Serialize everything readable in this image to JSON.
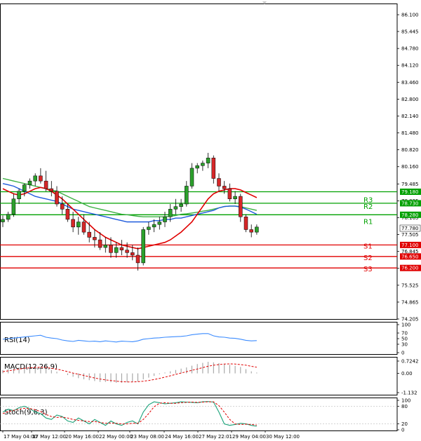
{
  "chart_data": {
    "type": "candlestick",
    "timeframe_labels": [
      "17 May 04:00",
      "17 May 12:00",
      "20 May 16:00",
      "22 May 00:00",
      "23 May 08:00",
      "24 May 16:00",
      "27 May 22:01",
      "29 May 04:00",
      "30 May 12:00"
    ],
    "price_ticks": [
      "86.100",
      "85.445",
      "84.780",
      "84.120",
      "83.460",
      "82.800",
      "82.140",
      "81.480",
      "80.820",
      "80.160",
      "79.485",
      "78.825",
      "78.165",
      "77.505",
      "76.845",
      "76.185",
      "75.525",
      "74.865",
      "74.205"
    ],
    "ylim": [
      74.205,
      86.1
    ],
    "current_price": "77.780",
    "candles": [
      {
        "o": 78.0,
        "h": 78.25,
        "l": 77.8,
        "c": 78.1
      },
      {
        "o": 78.1,
        "h": 78.4,
        "l": 78.0,
        "c": 78.3
      },
      {
        "o": 78.3,
        "h": 79.1,
        "l": 78.2,
        "c": 78.9
      },
      {
        "o": 78.9,
        "h": 79.3,
        "l": 78.7,
        "c": 79.2
      },
      {
        "o": 79.2,
        "h": 79.5,
        "l": 79.0,
        "c": 79.45
      },
      {
        "o": 79.45,
        "h": 79.7,
        "l": 79.3,
        "c": 79.6
      },
      {
        "o": 79.6,
        "h": 79.9,
        "l": 79.4,
        "c": 79.8
      },
      {
        "o": 79.8,
        "h": 80.1,
        "l": 79.5,
        "c": 79.6
      },
      {
        "o": 79.6,
        "h": 80.0,
        "l": 79.2,
        "c": 79.3
      },
      {
        "o": 79.3,
        "h": 79.6,
        "l": 79.0,
        "c": 79.2
      },
      {
        "o": 79.2,
        "h": 79.4,
        "l": 78.6,
        "c": 78.7
      },
      {
        "o": 78.7,
        "h": 79.0,
        "l": 78.3,
        "c": 78.5
      },
      {
        "o": 78.5,
        "h": 78.7,
        "l": 78.0,
        "c": 78.1
      },
      {
        "o": 78.1,
        "h": 78.4,
        "l": 77.6,
        "c": 77.8
      },
      {
        "o": 77.8,
        "h": 78.2,
        "l": 77.5,
        "c": 78.0
      },
      {
        "o": 78.0,
        "h": 78.3,
        "l": 77.5,
        "c": 77.6
      },
      {
        "o": 77.6,
        "h": 78.0,
        "l": 77.2,
        "c": 77.4
      },
      {
        "o": 77.4,
        "h": 77.7,
        "l": 77.0,
        "c": 77.3
      },
      {
        "o": 77.3,
        "h": 77.6,
        "l": 76.9,
        "c": 77.0
      },
      {
        "o": 77.0,
        "h": 77.4,
        "l": 76.8,
        "c": 77.1
      },
      {
        "o": 77.1,
        "h": 77.4,
        "l": 76.6,
        "c": 76.8
      },
      {
        "o": 76.8,
        "h": 77.2,
        "l": 76.6,
        "c": 77.0
      },
      {
        "o": 77.0,
        "h": 77.3,
        "l": 76.7,
        "c": 76.9
      },
      {
        "o": 76.9,
        "h": 77.2,
        "l": 76.6,
        "c": 76.8
      },
      {
        "o": 76.8,
        "h": 77.1,
        "l": 76.5,
        "c": 76.7
      },
      {
        "o": 76.7,
        "h": 77.0,
        "l": 76.1,
        "c": 76.4
      },
      {
        "o": 76.4,
        "h": 77.8,
        "l": 76.3,
        "c": 77.7
      },
      {
        "o": 77.7,
        "h": 78.0,
        "l": 77.5,
        "c": 77.8
      },
      {
        "o": 77.8,
        "h": 78.1,
        "l": 77.6,
        "c": 77.9
      },
      {
        "o": 77.9,
        "h": 78.2,
        "l": 77.7,
        "c": 78.0
      },
      {
        "o": 78.0,
        "h": 78.4,
        "l": 77.8,
        "c": 78.2
      },
      {
        "o": 78.2,
        "h": 78.7,
        "l": 78.0,
        "c": 78.5
      },
      {
        "o": 78.5,
        "h": 78.9,
        "l": 78.3,
        "c": 78.6
      },
      {
        "o": 78.6,
        "h": 78.9,
        "l": 78.4,
        "c": 78.7
      },
      {
        "o": 78.7,
        "h": 79.6,
        "l": 78.6,
        "c": 79.4
      },
      {
        "o": 79.4,
        "h": 80.3,
        "l": 79.3,
        "c": 80.1
      },
      {
        "o": 80.1,
        "h": 80.3,
        "l": 79.9,
        "c": 80.2
      },
      {
        "o": 80.2,
        "h": 80.4,
        "l": 80.0,
        "c": 80.3
      },
      {
        "o": 80.3,
        "h": 80.7,
        "l": 80.1,
        "c": 80.5
      },
      {
        "o": 80.5,
        "h": 80.6,
        "l": 79.5,
        "c": 79.7
      },
      {
        "o": 79.7,
        "h": 79.9,
        "l": 79.2,
        "c": 79.4
      },
      {
        "o": 79.4,
        "h": 79.6,
        "l": 79.1,
        "c": 79.3
      },
      {
        "o": 79.3,
        "h": 79.5,
        "l": 78.8,
        "c": 78.9
      },
      {
        "o": 78.9,
        "h": 79.2,
        "l": 78.7,
        "c": 79.0
      },
      {
        "o": 79.0,
        "h": 79.1,
        "l": 78.0,
        "c": 78.2
      },
      {
        "o": 78.2,
        "h": 78.3,
        "l": 77.6,
        "c": 77.7
      },
      {
        "o": 77.7,
        "h": 77.9,
        "l": 77.4,
        "c": 77.6
      },
      {
        "o": 77.6,
        "h": 77.9,
        "l": 77.5,
        "c": 77.8
      }
    ],
    "ma_red": [
      79.3,
      79.2,
      79.1,
      79.05,
      79.1,
      79.2,
      79.3,
      79.35,
      79.3,
      79.2,
      79.05,
      78.9,
      78.7,
      78.5,
      78.3,
      78.1,
      77.9,
      77.7,
      77.55,
      77.4,
      77.3,
      77.2,
      77.1,
      77.05,
      77.0,
      76.95,
      77.0,
      77.05,
      77.1,
      77.15,
      77.2,
      77.3,
      77.45,
      77.6,
      77.8,
      78.0,
      78.3,
      78.6,
      78.9,
      79.1,
      79.2,
      79.25,
      79.3,
      79.3,
      79.25,
      79.15,
      79.05,
      78.95
    ],
    "ma_green": [
      79.7,
      79.65,
      79.6,
      79.55,
      79.5,
      79.45,
      79.4,
      79.35,
      79.3,
      79.25,
      79.2,
      79.1,
      79.0,
      78.9,
      78.8,
      78.7,
      78.6,
      78.55,
      78.5,
      78.45,
      78.4,
      78.35,
      78.3,
      78.28,
      78.25,
      78.22,
      78.2,
      78.2,
      78.2,
      78.2,
      78.2,
      78.22,
      78.25,
      78.3,
      78.32,
      78.35,
      78.38,
      78.42,
      78.45,
      78.5,
      78.55,
      78.6,
      78.62,
      78.62,
      78.6,
      78.55,
      78.5,
      78.45
    ],
    "ma_blue": [
      79.5,
      79.45,
      79.4,
      79.3,
      79.2,
      79.1,
      79.0,
      78.95,
      78.9,
      78.85,
      78.8,
      78.7,
      78.6,
      78.5,
      78.45,
      78.4,
      78.35,
      78.3,
      78.25,
      78.2,
      78.15,
      78.1,
      78.05,
      78.0,
      78.0,
      78.0,
      78.0,
      78.0,
      78.05,
      78.05,
      78.1,
      78.1,
      78.15,
      78.15,
      78.2,
      78.25,
      78.3,
      78.35,
      78.4,
      78.45,
      78.55,
      78.6,
      78.62,
      78.62,
      78.58,
      78.5,
      78.4,
      78.3
    ],
    "levels": [
      {
        "label": "R3",
        "value": "79.180",
        "color": "#00a000"
      },
      {
        "label": "R2",
        "value": "78.730",
        "color": "#00a000"
      },
      {
        "label": "R1",
        "value": "78.280",
        "color": "#00a000"
      },
      {
        "label": "S1",
        "value": "77.100",
        "color": "#e00000"
      },
      {
        "label": "S2",
        "value": "76.650",
        "color": "#e00000"
      },
      {
        "label": "S3",
        "value": "76.200",
        "color": "#e00000"
      }
    ],
    "rsi": {
      "label": "RSI(14)",
      "ticks": [
        "100",
        "70",
        "50",
        "30",
        "0"
      ],
      "values": [
        48,
        50,
        52,
        54,
        56,
        58,
        60,
        62,
        55,
        52,
        50,
        45,
        42,
        40,
        44,
        42,
        40,
        41,
        39,
        42,
        40,
        38,
        41,
        40,
        39,
        42,
        48,
        50,
        52,
        53,
        55,
        56,
        57,
        58,
        60,
        64,
        66,
        68,
        68,
        60,
        56,
        55,
        52,
        51,
        48,
        44,
        42,
        43
      ]
    },
    "macd": {
      "label": "MACD(12,26,9)",
      "ticks": [
        "0.7242",
        "0.00",
        "-1.132"
      ],
      "histogram": [
        0.2,
        0.25,
        0.3,
        0.35,
        0.35,
        0.4,
        0.4,
        0.38,
        0.3,
        0.2,
        0.1,
        0.0,
        -0.1,
        -0.2,
        -0.28,
        -0.35,
        -0.4,
        -0.45,
        -0.5,
        -0.5,
        -0.52,
        -0.55,
        -0.55,
        -0.52,
        -0.5,
        -0.48,
        -0.35,
        -0.25,
        -0.15,
        -0.05,
        0.05,
        0.12,
        0.2,
        0.28,
        0.35,
        0.45,
        0.55,
        0.62,
        0.68,
        0.65,
        0.6,
        0.55,
        0.5,
        0.45,
        0.38,
        0.25,
        0.12,
        0.05
      ],
      "signal": [
        0.1,
        0.15,
        0.2,
        0.25,
        0.3,
        0.33,
        0.35,
        0.36,
        0.35,
        0.3,
        0.25,
        0.18,
        0.1,
        0.02,
        -0.05,
        -0.12,
        -0.2,
        -0.27,
        -0.33,
        -0.38,
        -0.42,
        -0.46,
        -0.49,
        -0.5,
        -0.5,
        -0.49,
        -0.46,
        -0.42,
        -0.36,
        -0.3,
        -0.22,
        -0.14,
        -0.06,
        0.02,
        0.1,
        0.18,
        0.26,
        0.34,
        0.42,
        0.48,
        0.52,
        0.55,
        0.56,
        0.55,
        0.52,
        0.48,
        0.42,
        0.36
      ]
    },
    "stoch": {
      "label": "Stoch(9,6,3)",
      "ticks": [
        "100",
        "80",
        "20",
        "0"
      ],
      "k": [
        60,
        70,
        65,
        75,
        80,
        72,
        60,
        55,
        40,
        35,
        50,
        45,
        30,
        25,
        40,
        30,
        20,
        35,
        25,
        15,
        30,
        20,
        15,
        25,
        30,
        20,
        60,
        85,
        95,
        92,
        88,
        90,
        92,
        95,
        94,
        93,
        92,
        95,
        96,
        94,
        60,
        20,
        15,
        18,
        22,
        20,
        15,
        12
      ],
      "d": [
        55,
        62,
        66,
        70,
        73,
        72,
        68,
        62,
        52,
        45,
        42,
        43,
        40,
        35,
        32,
        30,
        28,
        28,
        25,
        22,
        23,
        22,
        20,
        20,
        22,
        22,
        35,
        55,
        78,
        90,
        92,
        90,
        90,
        92,
        93,
        94,
        93,
        94,
        95,
        95,
        82,
        60,
        35,
        20,
        18,
        19,
        18,
        16
      ]
    }
  }
}
